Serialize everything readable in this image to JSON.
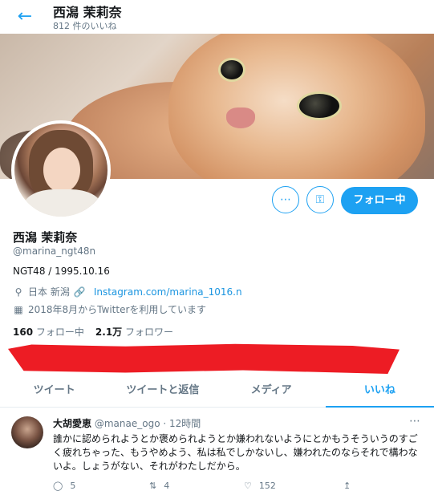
{
  "header": {
    "back_icon": "arrow-left-icon",
    "title": "西潟 茉莉奈",
    "subtitle": "812 件のいいね"
  },
  "profile": {
    "name": "西潟 茉莉奈",
    "handle": "@marina_ngt48n",
    "bio": "NGT48 /  1995.10.16",
    "location": "日本 新潟",
    "link": "Instagram.com/marina_1016.n",
    "joined": "2018年8月からTwitterを利用しています",
    "following_count": "160",
    "following_label": "フォロー中",
    "followers_count": "2.1万",
    "followers_label": "フォロワー",
    "follow_button": "フォロー中",
    "more_icon": "…",
    "bell_icon": "⊕"
  },
  "tabs": [
    {
      "label": "ツイート",
      "active": false
    },
    {
      "label": "ツイートと返信",
      "active": false
    },
    {
      "label": "メディア",
      "active": false
    },
    {
      "label": "いいね",
      "active": true
    }
  ],
  "tweet": {
    "name": "大胡愛恵",
    "handle": "@manae_ogo",
    "separator": "·",
    "time": "12時間",
    "text": "誰かに認められようとか褒められようとか嫌われないようにとかもうそういうのすごく疲れちゃった、もうやめよう、私は私でしかないし、嫌われたのならそれで構わないよ。しょうがない、それがわたしだから。",
    "replies": "5",
    "retweets": "4",
    "likes": "152"
  },
  "colors": {
    "accent": "#1da1f2",
    "muted": "#657786",
    "redaction": "#ed1c24"
  }
}
